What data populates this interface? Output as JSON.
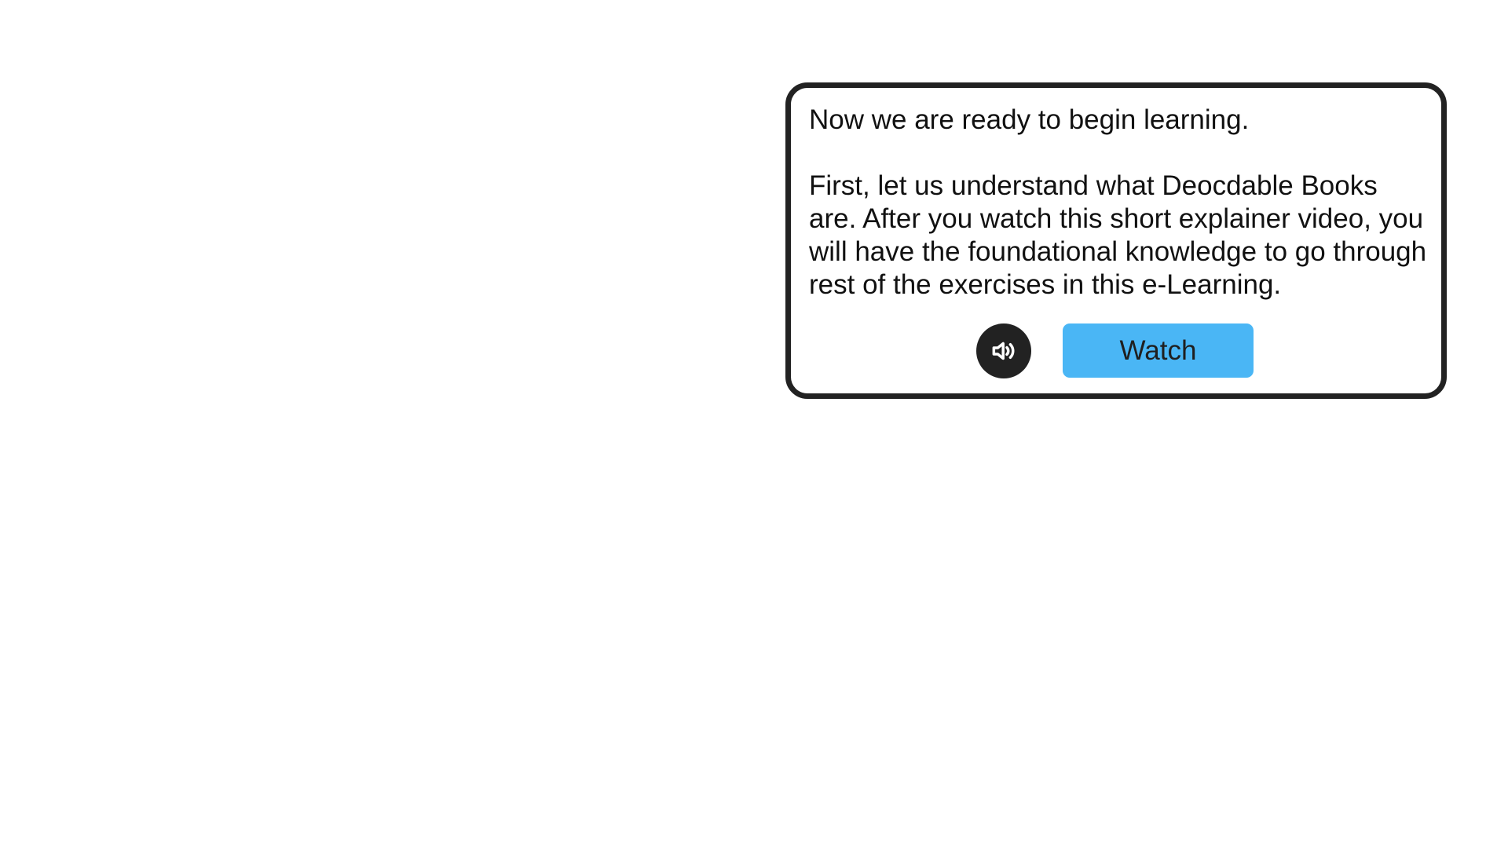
{
  "dialog": {
    "line1": "Now we are ready to begin learning.",
    "line2": "First, let us understand what Deocdable Books are. After you watch this short explainer video, you will have the foundational knowledge to go through rest of the exercises in this e-Learning.",
    "audio_icon": "speaker-icon",
    "watch_label": "Watch"
  },
  "colors": {
    "border": "#222222",
    "button_bg": "#4ab6f5",
    "audio_bg": "#222222"
  }
}
